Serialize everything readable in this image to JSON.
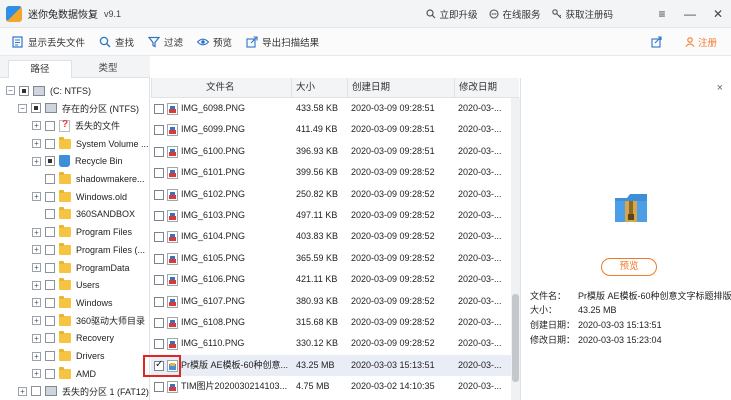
{
  "titlebar": {
    "app_name": "迷你兔数据恢复",
    "version": "v9.1",
    "links": [
      {
        "label": "立即升级",
        "icon": "search-icon"
      },
      {
        "label": "在线服务",
        "icon": "chat-icon"
      },
      {
        "label": "获取注册码",
        "icon": "key-icon"
      }
    ],
    "controls": [
      "≡",
      "—",
      "✕"
    ]
  },
  "toolbar": {
    "items": [
      {
        "label": "显示丢失文件",
        "icon": "list-icon"
      },
      {
        "label": "查找",
        "icon": "search-icon"
      },
      {
        "label": "过滤",
        "icon": "filter-icon"
      },
      {
        "label": "预览",
        "icon": "eye-icon"
      },
      {
        "label": "导出扫描结果",
        "icon": "export-icon"
      }
    ],
    "register_label": "注册"
  },
  "left_tabs": [
    "路径",
    "类型"
  ],
  "tree": [
    {
      "label": "(C: NTFS)",
      "indent": 0,
      "expander": "−",
      "check": "part",
      "icon": "drive"
    },
    {
      "label": "存在的分区 (NTFS)",
      "indent": 1,
      "expander": "−",
      "check": "part",
      "icon": "drive"
    },
    {
      "label": "丢失的文件",
      "indent": 2,
      "expander": "+",
      "check": "",
      "icon": "lostfile"
    },
    {
      "label": "System Volume ...",
      "indent": 2,
      "expander": "+",
      "check": "",
      "icon": "folder"
    },
    {
      "label": "Recycle Bin",
      "indent": 2,
      "expander": "+",
      "check": "part",
      "icon": "recycle"
    },
    {
      "label": "shadowmakere...",
      "indent": 2,
      "expander": "",
      "check": "",
      "icon": "folder"
    },
    {
      "label": "Windows.old",
      "indent": 2,
      "expander": "+",
      "check": "",
      "icon": "folder"
    },
    {
      "label": "360SANDBOX",
      "indent": 2,
      "expander": "",
      "check": "",
      "icon": "folder"
    },
    {
      "label": "Program Files",
      "indent": 2,
      "expander": "+",
      "check": "",
      "icon": "folder"
    },
    {
      "label": "Program Files (...",
      "indent": 2,
      "expander": "+",
      "check": "",
      "icon": "folder"
    },
    {
      "label": "ProgramData",
      "indent": 2,
      "expander": "+",
      "check": "",
      "icon": "folder"
    },
    {
      "label": "Users",
      "indent": 2,
      "expander": "+",
      "check": "",
      "icon": "folder"
    },
    {
      "label": "Windows",
      "indent": 2,
      "expander": "+",
      "check": "",
      "icon": "folder"
    },
    {
      "label": "360驱动大师目录",
      "indent": 2,
      "expander": "+",
      "check": "",
      "icon": "folder"
    },
    {
      "label": "Recovery",
      "indent": 2,
      "expander": "+",
      "check": "",
      "icon": "folder"
    },
    {
      "label": "Drivers",
      "indent": 2,
      "expander": "+",
      "check": "",
      "icon": "folder"
    },
    {
      "label": "AMD",
      "indent": 2,
      "expander": "+",
      "check": "",
      "icon": "folder"
    },
    {
      "label": "丢失的分区 1 (FAT12)",
      "indent": 1,
      "expander": "+",
      "check": "",
      "icon": "drive"
    }
  ],
  "columns": [
    "文件名",
    "大小",
    "创建日期",
    "修改日期"
  ],
  "files": [
    {
      "name": "IMG_6098.PNG",
      "size": "433.58 KB",
      "created": "2020-03-09 09:28:51",
      "modified": "2020-03-...",
      "checked": false,
      "type": "png"
    },
    {
      "name": "IMG_6099.PNG",
      "size": "411.49 KB",
      "created": "2020-03-09 09:28:51",
      "modified": "2020-03-...",
      "checked": false,
      "type": "png"
    },
    {
      "name": "IMG_6100.PNG",
      "size": "396.93 KB",
      "created": "2020-03-09 09:28:51",
      "modified": "2020-03-...",
      "checked": false,
      "type": "png"
    },
    {
      "name": "IMG_6101.PNG",
      "size": "399.56 KB",
      "created": "2020-03-09 09:28:52",
      "modified": "2020-03-...",
      "checked": false,
      "type": "png"
    },
    {
      "name": "IMG_6102.PNG",
      "size": "250.82 KB",
      "created": "2020-03-09 09:28:52",
      "modified": "2020-03-...",
      "checked": false,
      "type": "png"
    },
    {
      "name": "IMG_6103.PNG",
      "size": "497.11 KB",
      "created": "2020-03-09 09:28:52",
      "modified": "2020-03-...",
      "checked": false,
      "type": "png"
    },
    {
      "name": "IMG_6104.PNG",
      "size": "403.83 KB",
      "created": "2020-03-09 09:28:52",
      "modified": "2020-03-...",
      "checked": false,
      "type": "png"
    },
    {
      "name": "IMG_6105.PNG",
      "size": "365.59 KB",
      "created": "2020-03-09 09:28:52",
      "modified": "2020-03-...",
      "checked": false,
      "type": "png"
    },
    {
      "name": "IMG_6106.PNG",
      "size": "421.11 KB",
      "created": "2020-03-09 09:28:52",
      "modified": "2020-03-...",
      "checked": false,
      "type": "png"
    },
    {
      "name": "IMG_6107.PNG",
      "size": "380.93 KB",
      "created": "2020-03-09 09:28:52",
      "modified": "2020-03-...",
      "checked": false,
      "type": "png"
    },
    {
      "name": "IMG_6108.PNG",
      "size": "315.68 KB",
      "created": "2020-03-09 09:28:52",
      "modified": "2020-03-...",
      "checked": false,
      "type": "png"
    },
    {
      "name": "IMG_6110.PNG",
      "size": "330.12 KB",
      "created": "2020-03-09 09:28:52",
      "modified": "2020-03-...",
      "checked": false,
      "type": "png"
    },
    {
      "name": "Pr模版 AE模板-60种创意...",
      "size": "43.25 MB",
      "created": "2020-03-03 15:13:51",
      "modified": "2020-03-...",
      "checked": true,
      "type": "zip"
    },
    {
      "name": "TIM图片2020030214103...",
      "size": "4.75 MB",
      "created": "2020-03-02 14:10:35",
      "modified": "2020-03-...",
      "checked": false,
      "type": "png"
    }
  ],
  "preview": {
    "close": "×",
    "button_label": "预览",
    "info": [
      {
        "key": "文件名：",
        "value": "Pr模版 AE模板-60种创意文字标题排版"
      },
      {
        "key": "大小：",
        "value": "43.25 MB"
      },
      {
        "key": "创建日期：",
        "value": "2020-03-03 15:13:51"
      },
      {
        "key": "修改日期：",
        "value": "2020-03-03 15:23:04"
      }
    ]
  }
}
